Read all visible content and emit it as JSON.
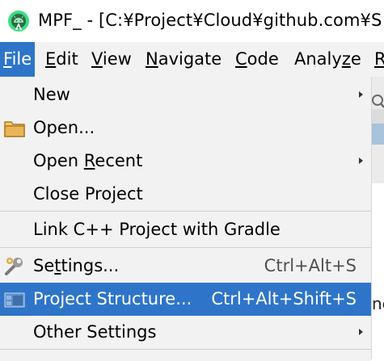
{
  "window": {
    "title": "MPF_ - [C:¥Project¥Cloud¥github.com¥S"
  },
  "menubar": {
    "items": [
      {
        "mnemonic": "F",
        "rest": "ile",
        "active": true
      },
      {
        "mnemonic": "E",
        "rest": "dit",
        "active": false
      },
      {
        "mnemonic": "V",
        "rest": "iew",
        "active": false
      },
      {
        "mnemonic": "N",
        "rest": "avigate",
        "active": false
      },
      {
        "mnemonic": "C",
        "rest": "ode",
        "active": false
      },
      {
        "pre": "Analy",
        "mnemonic": "z",
        "rest": "e",
        "active": false
      },
      {
        "mnemonic": "R",
        "rest": "",
        "active": false
      }
    ]
  },
  "file_menu": {
    "new": {
      "label": "New",
      "has_submenu": true
    },
    "open": {
      "label": "Open...",
      "icon": "folder-icon"
    },
    "open_recent": {
      "pre": "Open ",
      "mnemonic": "R",
      "rest": "ecent",
      "has_submenu": true
    },
    "close_project": {
      "label": "Close Project"
    },
    "link_cpp": {
      "label": "Link C++ Project with Gradle"
    },
    "settings": {
      "pre": "Se",
      "mnemonic": "t",
      "rest": "tings...",
      "shortcut": "Ctrl+Alt+S",
      "icon": "wrench-icon"
    },
    "project_structure": {
      "label": "Project Structure...",
      "shortcut": "Ctrl+Alt+Shift+S",
      "icon": "project-structure-icon",
      "selected": true
    },
    "other_settings": {
      "label": "Other Settings",
      "has_submenu": true
    }
  },
  "background": {
    "fragment": "nc"
  },
  "colors": {
    "accent": "#2e75c9",
    "menu_bg": "#f2f2f2",
    "titlebar_bg": "#ffffff",
    "android_green": "#a4c639",
    "folder": "#e0a84a"
  }
}
